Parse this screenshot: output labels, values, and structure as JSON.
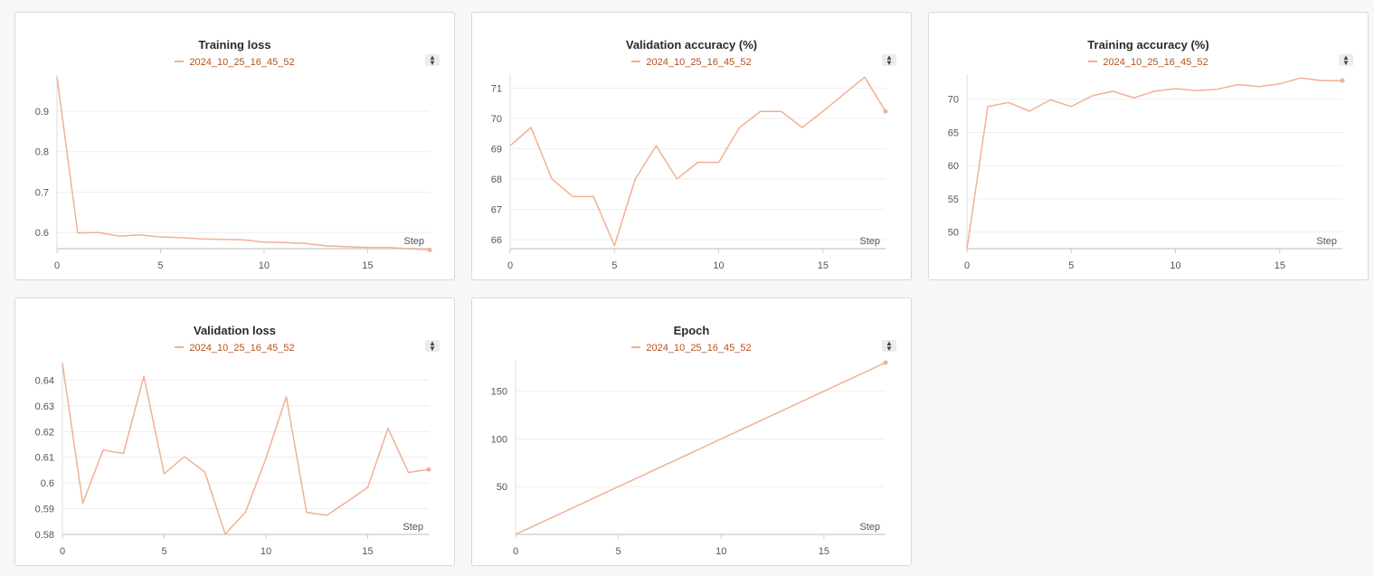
{
  "legend_run": "2024_10_25_16_45_52",
  "x_label": "Step",
  "colors": {
    "series": "#f0b191",
    "legend_text": "#b5521b"
  },
  "sort_icon": "sort-arrows-icon",
  "chart_data": [
    {
      "type": "line",
      "title": "Training loss",
      "x": [
        0,
        1,
        2,
        3,
        4,
        5,
        6,
        7,
        8,
        9,
        10,
        11,
        12,
        13,
        14,
        15,
        16,
        17,
        18
      ],
      "series": [
        {
          "name": "2024_10_25_16_45_52",
          "values": [
            0.985,
            0.599,
            0.6,
            0.591,
            0.594,
            0.589,
            0.587,
            0.584,
            0.583,
            0.582,
            0.576,
            0.575,
            0.573,
            0.567,
            0.565,
            0.563,
            0.563,
            0.56,
            0.557
          ]
        }
      ],
      "xlim": [
        0,
        18
      ],
      "ylim": [
        0.56,
        0.985
      ],
      "xticks": [
        0,
        5,
        10,
        15
      ],
      "yticks": [
        0.6,
        0.7,
        0.8,
        0.9
      ],
      "ytick_labels": [
        "0.6",
        "0.7",
        "0.8",
        "0.9"
      ],
      "xlabel": "Step",
      "grid": true
    },
    {
      "type": "line",
      "title": "Validation accuracy (%)",
      "x": [
        0,
        1,
        2,
        3,
        4,
        5,
        6,
        7,
        8,
        9,
        10,
        11,
        12,
        13,
        14,
        15,
        16,
        17,
        18
      ],
      "series": [
        {
          "name": "2024_10_25_16_45_52",
          "values": [
            69.1,
            69.7,
            68.0,
            67.42,
            67.42,
            65.8,
            68.0,
            69.1,
            68.0,
            68.55,
            68.55,
            69.7,
            70.23,
            70.23,
            69.7,
            70.23,
            70.8,
            71.36,
            70.23
          ]
        }
      ],
      "xlim": [
        0,
        18
      ],
      "ylim": [
        65.7,
        71.4
      ],
      "xticks": [
        0,
        5,
        10,
        15
      ],
      "yticks": [
        66,
        67,
        68,
        69,
        70,
        71
      ],
      "ytick_labels": [
        "66",
        "67",
        "68",
        "69",
        "70",
        "71"
      ],
      "xlabel": "Step",
      "grid": true
    },
    {
      "type": "line",
      "title": "Training accuracy (%)",
      "x": [
        0,
        1,
        2,
        3,
        4,
        5,
        6,
        7,
        8,
        9,
        10,
        11,
        12,
        13,
        14,
        15,
        16,
        17,
        18
      ],
      "series": [
        {
          "name": "2024_10_25_16_45_52",
          "values": [
            47.5,
            68.9,
            69.5,
            68.2,
            69.9,
            68.9,
            70.5,
            71.2,
            70.2,
            71.2,
            71.6,
            71.3,
            71.5,
            72.2,
            71.9,
            72.3,
            73.2,
            72.8,
            72.8
          ]
        }
      ],
      "xlim": [
        0,
        18
      ],
      "ylim": [
        47.5,
        73.5
      ],
      "xticks": [
        0,
        5,
        10,
        15
      ],
      "yticks": [
        50,
        55,
        60,
        65,
        70
      ],
      "ytick_labels": [
        "50",
        "55",
        "60",
        "65",
        "70"
      ],
      "xlabel": "Step",
      "grid": true
    },
    {
      "type": "line",
      "title": "Validation loss",
      "x": [
        0,
        1,
        2,
        3,
        4,
        5,
        6,
        7,
        8,
        9,
        10,
        11,
        12,
        13,
        14,
        15,
        16,
        17,
        18
      ],
      "series": [
        {
          "name": "2024_10_25_16_45_52",
          "values": [
            0.6465,
            0.5922,
            0.6128,
            0.6115,
            0.6415,
            0.6036,
            0.6103,
            0.6042,
            0.5801,
            0.5887,
            0.6096,
            0.6335,
            0.5885,
            0.5875,
            0.5928,
            0.5983,
            0.6213,
            0.6041,
            0.6053
          ]
        }
      ],
      "xlim": [
        0,
        18
      ],
      "ylim": [
        0.58,
        0.6465
      ],
      "xticks": [
        0,
        5,
        10,
        15
      ],
      "yticks": [
        0.58,
        0.59,
        0.6,
        0.61,
        0.62,
        0.63,
        0.64
      ],
      "ytick_labels": [
        "0.58",
        "0.59",
        "0.6",
        "0.61",
        "0.62",
        "0.63",
        "0.64"
      ],
      "xlabel": "Step",
      "grid": true
    },
    {
      "type": "line",
      "title": "Epoch",
      "x": [
        0,
        1,
        2,
        3,
        4,
        5,
        6,
        7,
        8,
        9,
        10,
        11,
        12,
        13,
        14,
        15,
        16,
        17,
        18
      ],
      "series": [
        {
          "name": "2024_10_25_16_45_52",
          "values": [
            0,
            10,
            20,
            30,
            40,
            50,
            60,
            70,
            80,
            90,
            100,
            110,
            120,
            130,
            140,
            150,
            160,
            170,
            180
          ]
        }
      ],
      "xlim": [
        0,
        18
      ],
      "ylim": [
        0,
        180
      ],
      "xticks": [
        0,
        5,
        10,
        15
      ],
      "yticks": [
        50,
        100,
        150
      ],
      "ytick_labels": [
        "50",
        "100",
        "150"
      ],
      "xlabel": "Step",
      "grid": true
    }
  ]
}
